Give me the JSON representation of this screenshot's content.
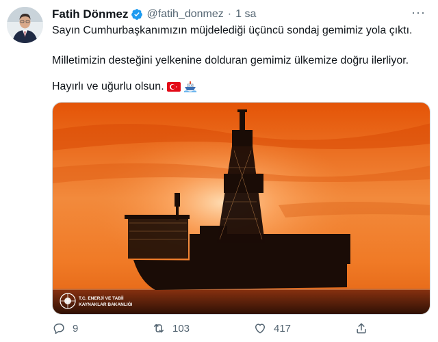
{
  "tweet": {
    "author_name": "Fatih Dönmez",
    "handle": "@fatih_donmez",
    "separator": "·",
    "time": "1 sa",
    "more_label": "···",
    "lines": [
      "Sayın Cumhurbaşkanımızın müjdelediği üçüncü sondaj gemimiz yola çıktı.",
      "Milletimizin desteğini yelkenine dolduran gemimiz ülkemize doğru ilerliyor.",
      "Hayırlı ve uğurlu olsun."
    ],
    "emojis": [
      "turkey-flag",
      "ship"
    ]
  },
  "media": {
    "watermark_line1": "T.C. ENERJİ VE TABİİ",
    "watermark_line2": "KAYNAKLAR BAKANLIĞI",
    "sky_colors": [
      "#e85a0c",
      "#f7a15c",
      "#d84a05"
    ]
  },
  "actions": {
    "reply_count": "9",
    "retweet_count": "103",
    "like_count": "417"
  },
  "colors": {
    "verified": "#1d9bf0",
    "secondary_text": "#536471"
  }
}
